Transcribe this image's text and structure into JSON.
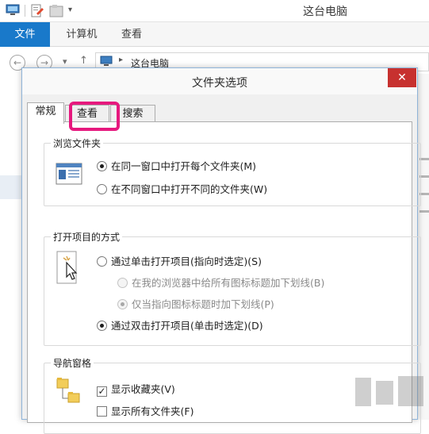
{
  "window": {
    "title": "这台电脑"
  },
  "ribbon": {
    "tabs": [
      "文件",
      "计算机",
      "查看"
    ]
  },
  "address_bar": {
    "path": "这台电脑"
  },
  "dialog": {
    "title": "文件夹选项",
    "close_glyph": "✕",
    "tabs": [
      "常规",
      "查看",
      "搜索"
    ],
    "active_tab": "常规",
    "highlight_color": "#e6197e",
    "groups": {
      "browse": {
        "title": "浏览文件夹",
        "options": [
          {
            "label": "在同一窗口中打开每个文件夹(M)",
            "selected": true
          },
          {
            "label": "在不同窗口中打开不同的文件夹(W)",
            "selected": false
          }
        ]
      },
      "open_items": {
        "title": "打开项目的方式",
        "options": [
          {
            "label": "通过单击打开项目(指向时选定)(S)",
            "selected": false
          },
          {
            "label": "在我的浏览器中给所有图标标题加下划线(B)",
            "selected": false,
            "disabled": true
          },
          {
            "label": "仅当指向图标标题时加下划线(P)",
            "selected": true,
            "disabled": true
          },
          {
            "label": "通过双击打开项目(单击时选定)(D)",
            "selected": true
          }
        ]
      },
      "nav_pane": {
        "title": "导航窗格",
        "options": [
          {
            "label": "显示收藏夹(V)",
            "checked": true
          },
          {
            "label": "显示所有文件夹(F)",
            "checked": false
          }
        ]
      }
    }
  },
  "colors": {
    "file_tab": "#1979ca",
    "close_button": "#c7312f"
  }
}
